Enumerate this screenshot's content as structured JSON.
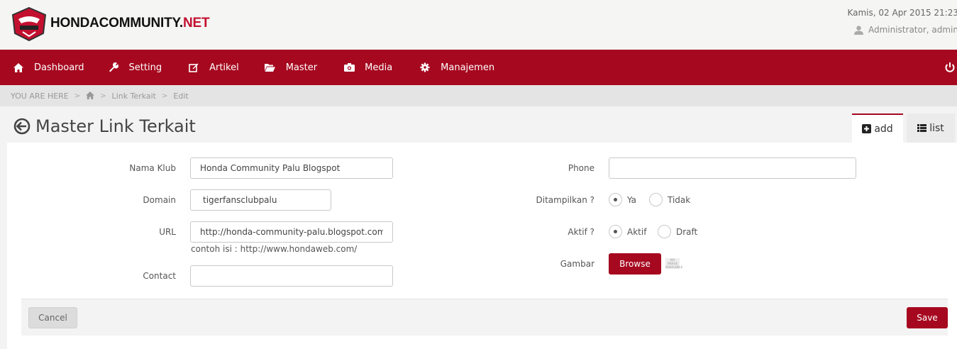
{
  "header": {
    "logo_main": "HONDACOMMUNITY.",
    "logo_accent": "NET",
    "date": "Kamis, 02 Apr 2015 21:23",
    "user": "Administrator, admin"
  },
  "nav": {
    "items": [
      {
        "label": "Dashboard",
        "icon": "home-icon"
      },
      {
        "label": "Setting",
        "icon": "wrench-icon"
      },
      {
        "label": "Artikel",
        "icon": "edit-icon"
      },
      {
        "label": "Master",
        "icon": "folder-open-icon"
      },
      {
        "label": "Media",
        "icon": "camera-icon"
      },
      {
        "label": "Manajemen",
        "icon": "gear-icon"
      }
    ],
    "power_icon": "power-icon"
  },
  "breadcrumb": {
    "prefix": "YOU ARE HERE",
    "items": [
      "Link Terkait",
      "Edit"
    ]
  },
  "page": {
    "title": "Master Link Terkait",
    "tab_add": "add",
    "tab_list": "list"
  },
  "form": {
    "nama_klub": {
      "label": "Nama Klub",
      "value": "Honda Community Palu Blogspot"
    },
    "domain": {
      "label": "Domain",
      "value": "tigerfansclubpalu"
    },
    "url": {
      "label": "URL",
      "value": "http://honda-community-palu.blogspot.com/",
      "help": "contoh isi : http://www.hondaweb.com/"
    },
    "contact": {
      "label": "Contact",
      "value": ""
    },
    "phone": {
      "label": "Phone",
      "value": ""
    },
    "ditampilkan": {
      "label": "Ditampilkan ?",
      "options": [
        "Ya",
        "Tidak"
      ],
      "selected": "Ya"
    },
    "aktif": {
      "label": "Aktif ?",
      "options": [
        "Aktif",
        "Draft"
      ],
      "selected": "Aktif"
    },
    "gambar": {
      "label": "Gambar",
      "browse_label": "Browse",
      "placeholder_image_text": "NO IMAGE AVAILABLE"
    }
  },
  "actions": {
    "cancel_label": "Cancel",
    "save_label": "Save"
  },
  "colors": {
    "brand": "#a6081f",
    "accent_net": "#c3102f"
  }
}
